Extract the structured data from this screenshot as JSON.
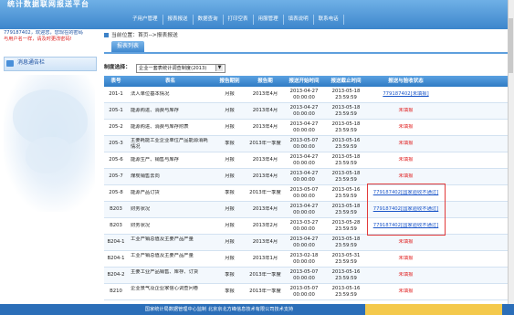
{
  "header": {
    "brand": "统计数据联网报送平台",
    "nav": [
      "子用户管理",
      "报表报送",
      "数据查询",
      "打印空表",
      "用服管理",
      "填表说明",
      "联系电话"
    ]
  },
  "sidebar": {
    "user_line1": "779187402，欢迎您，您现在的密码",
    "user_line2": "与用户名一样，请及时更改密码!",
    "notice_label": "消息通告栏"
  },
  "main": {
    "breadcrumb": "当前位置：首页-->报表报送",
    "tab_label": "报表列表",
    "filter_label": "制度选择：",
    "filter_value": "企业一套表统计调查制度(2013)"
  },
  "table": {
    "headers": [
      "表号",
      "表名",
      "报告期别",
      "报告期",
      "报送开始时间",
      "报送截止时间",
      "报送与验收状态"
    ],
    "rows": [
      {
        "code": "201-1",
        "name": "法人单位基本情况",
        "freq": "月报",
        "period": "2013年4月",
        "start": "2013-04-27 00:00:00",
        "end": "2013-05-18 23:59:59",
        "status": "779187402[未填报]",
        "status_type": "blue"
      },
      {
        "code": "205-1",
        "name": "能源购进、消费与库存",
        "freq": "月报",
        "period": "2013年4月",
        "start": "2013-04-27 00:00:00",
        "end": "2013-05-18 23:59:59",
        "status": "未填报",
        "status_type": "red"
      },
      {
        "code": "205-2",
        "name": "能源购进、消费与库存附表",
        "freq": "月报",
        "period": "2013年4月",
        "start": "2013-04-27 00:00:00",
        "end": "2013-05-18 23:59:59",
        "status": "未填报",
        "status_type": "red"
      },
      {
        "code": "205-3",
        "name": "主要耗能工业企业单位产品能源消耗情况",
        "freq": "季报",
        "period": "2013年一季度",
        "start": "2013-05-07 00:00:00",
        "end": "2013-05-16 23:59:59",
        "status": "未填报",
        "status_type": "red"
      },
      {
        "code": "205-6",
        "name": "能源生产、销售与库存",
        "freq": "月报",
        "period": "2013年4月",
        "start": "2013-04-27 00:00:00",
        "end": "2013-05-18 23:59:59",
        "status": "未填报",
        "status_type": "red"
      },
      {
        "code": "205-7",
        "name": "煤炭销售去向",
        "freq": "月报",
        "period": "2013年4月",
        "start": "2013-04-27 00:00:00",
        "end": "2013-05-18 23:59:59",
        "status": "未填报",
        "status_type": "red"
      },
      {
        "code": "205-8",
        "name": "能源产品订货",
        "freq": "季报",
        "period": "2013年一季度",
        "start": "2013-05-07 00:00:00",
        "end": "2013-05-16 23:59:59",
        "status": "779187402[国家验收不通过]",
        "status_type": "blue"
      },
      {
        "code": "B203",
        "name": "财务状况",
        "freq": "月报",
        "period": "2013年4月",
        "start": "2013-04-27 00:00:00",
        "end": "2013-05-18 23:59:59",
        "status": "779187402[国家验收不通过]",
        "status_type": "blue"
      },
      {
        "code": "B203",
        "name": "财务状况",
        "freq": "月报",
        "period": "2013年2月",
        "start": "2013-03-27 00:00:00",
        "end": "2013-05-28 23:59:59",
        "status": "779187402[国家验收不通过]",
        "status_type": "blue"
      },
      {
        "code": "B204-1",
        "name": "工业产销总值及主要产品产量",
        "freq": "月报",
        "period": "2013年4月",
        "start": "2013-04-27 00:00:00",
        "end": "2013-05-18 23:59:59",
        "status": "未填报",
        "status_type": "red"
      },
      {
        "code": "B204-1",
        "name": "工业产销总值及主要产品产量",
        "freq": "月报",
        "period": "2013年1月",
        "start": "2013-02-18 00:00:00",
        "end": "2013-05-31 23:59:59",
        "status": "未填报",
        "status_type": "red"
      },
      {
        "code": "B204-2",
        "name": "主要工业产品销售、库存、订货",
        "freq": "季报",
        "period": "2013年一季度",
        "start": "2013-05-07 00:00:00",
        "end": "2013-05-16 23:59:59",
        "status": "未填报",
        "status_type": "red"
      },
      {
        "code": "B210",
        "name": "企业景气及企业家信心调查问卷",
        "freq": "季报",
        "period": "2013年一季度",
        "start": "2013-05-07 00:00:00",
        "end": "2013-05-16 23:59:59",
        "status": "未填报",
        "status_type": "red"
      }
    ]
  },
  "footer": {
    "text": "国家统计局数据管理中心监制 北京京北方峰信息技术有限公司技术支持"
  }
}
